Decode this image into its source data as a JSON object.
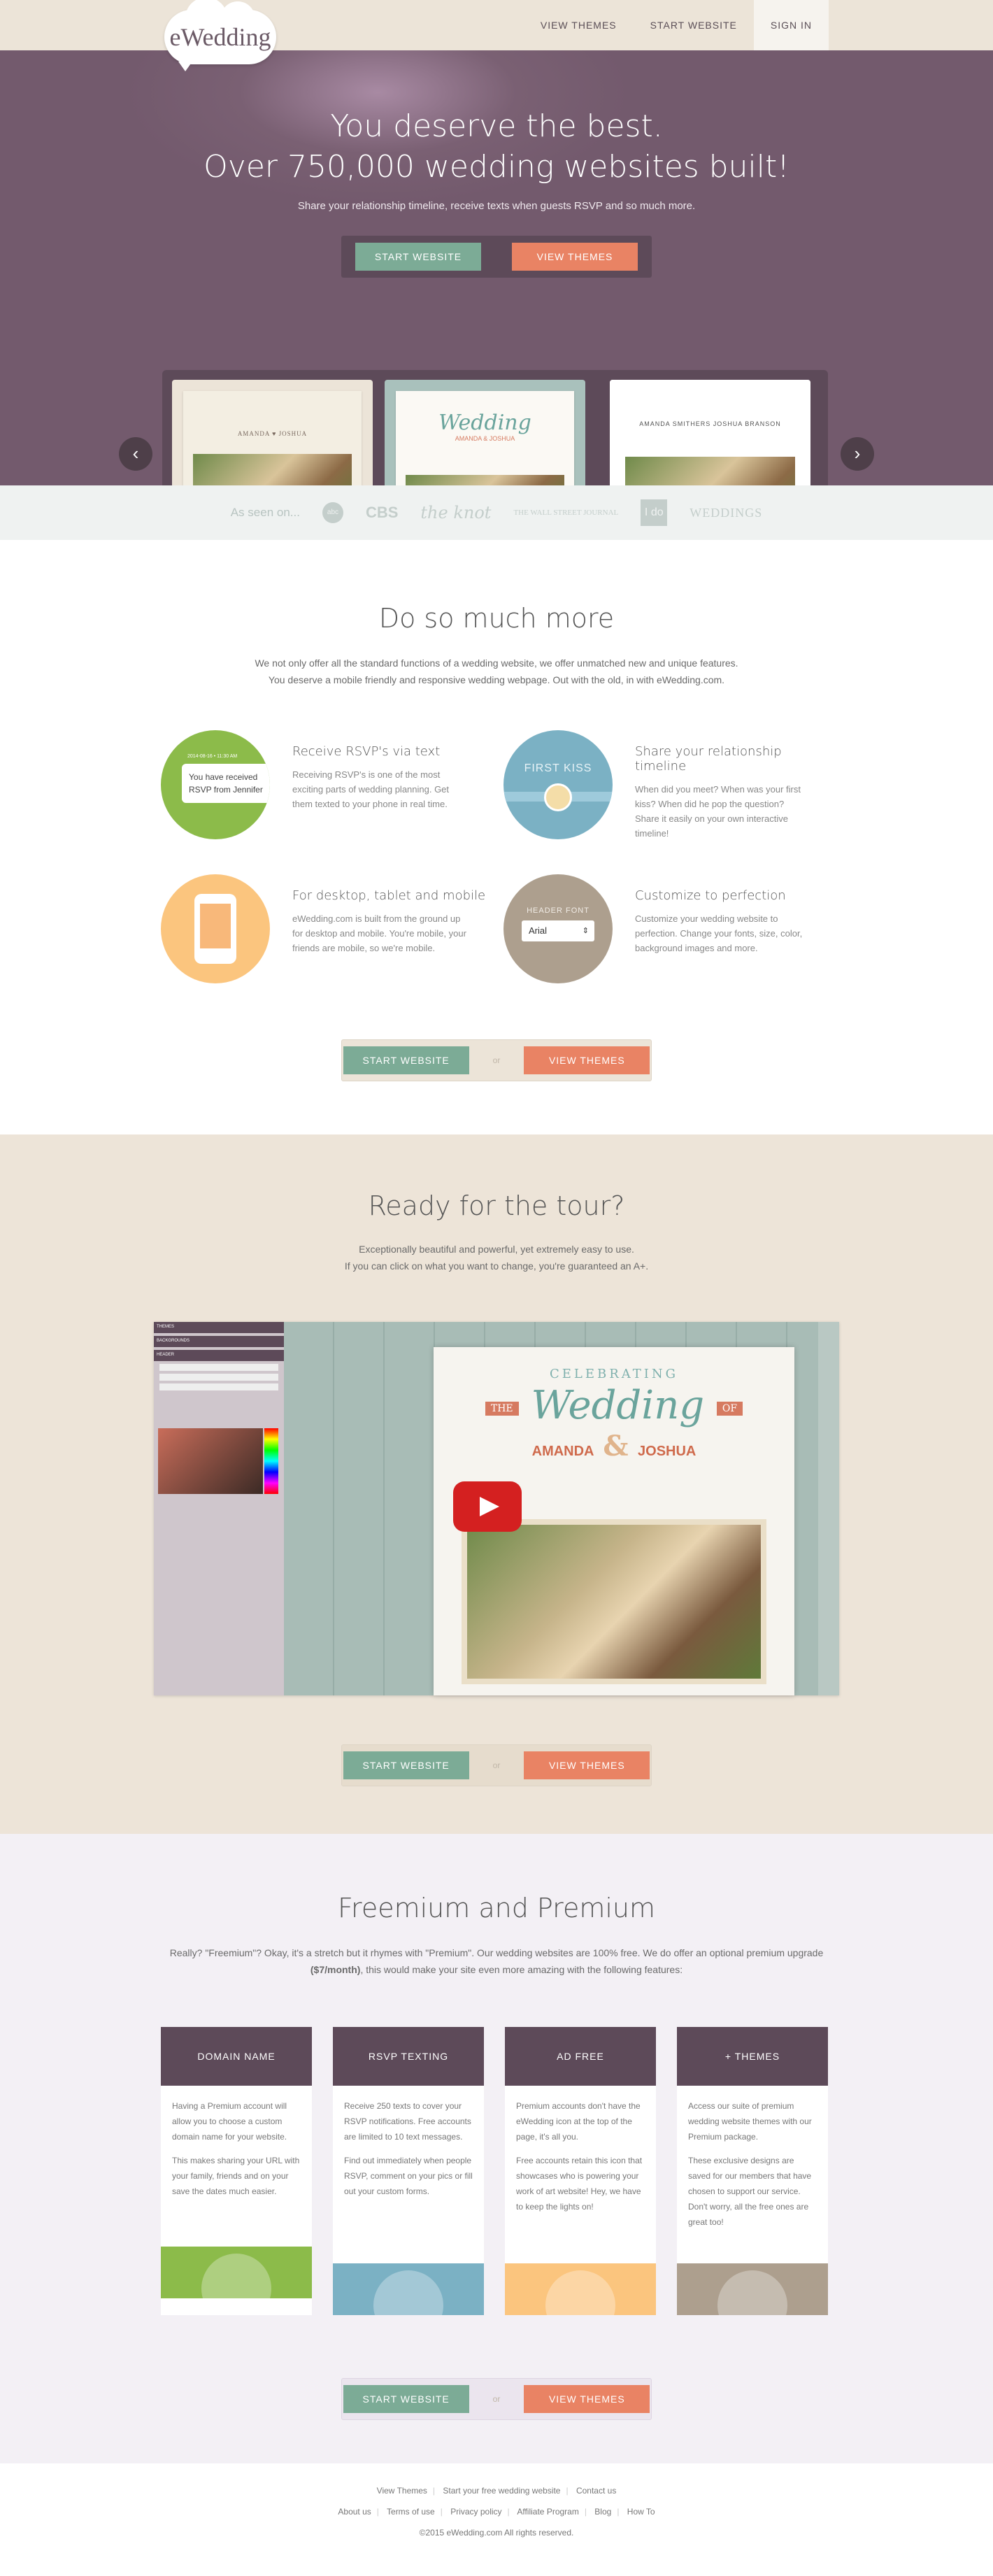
{
  "nav": {
    "logo": "eWedding",
    "links": [
      "VIEW THEMES",
      "START WEBSITE",
      "SIGN IN"
    ]
  },
  "hero": {
    "title_line1": "You deserve the best.",
    "title_line2": "Over 750,000 wedding websites built!",
    "subtitle": "Share your relationship timeline, receive texts when guests RSVP and so much more.",
    "start_btn": "START WEBSITE",
    "themes_btn": "VIEW THEMES",
    "cards": [
      {
        "text": "AMANDA  ♥  JOSHUA"
      },
      {
        "text": "Wedding",
        "names": "AMANDA & JOSHUA"
      },
      {
        "text": "AMANDA SMITHERS      JOSHUA BRANSON"
      }
    ],
    "prev_arrow": "‹",
    "next_arrow": "›"
  },
  "seen": {
    "label": "As seen on...",
    "brands": [
      "abc",
      "CBS",
      "the knot",
      "THE WALL STREET JOURNAL",
      "I do",
      "WEDDINGS"
    ]
  },
  "more": {
    "title": "Do so much more",
    "intro1": "We not only offer all the standard functions of a wedding website, we offer unmatched new and unique features.",
    "intro2": "You deserve a mobile friendly and responsive wedding webpage. Out with the old, in with eWedding.com.",
    "features": [
      {
        "title": "Receive RSVP's via text",
        "text": "Receiving RSVP's is one of the most exciting parts of wedding planning. Get them texted to your phone in real time.",
        "bubble": "You have received RSVP from Jennifer",
        "bubble_date": "2014-08-16 • 11:30 AM"
      },
      {
        "title": "Share your relationship timeline",
        "text": "When did you meet? When was your first kiss? When did he pop the question? Share it easily on your own interactive timeline!",
        "label": "FIRST KISS"
      },
      {
        "title": "For desktop, tablet and mobile",
        "text": "eWedding.com is built from the ground up for desktop and mobile. You're mobile, your friends are mobile, so we're mobile."
      },
      {
        "title": "Customize to perfection",
        "text": "Customize your wedding website to perfection. Change your fonts, size, color, background images and more.",
        "label": "HEADER FONT",
        "select": "Arial"
      }
    ],
    "start_btn": "START WEBSITE",
    "or": "or",
    "themes_btn": "VIEW THEMES"
  },
  "tour": {
    "title": "Ready for the tour?",
    "intro1": "Exceptionally beautiful and powerful, yet extremely easy to use.",
    "intro2": "If you can click on what you want to change, you're guaranteed an A+.",
    "video": {
      "side_bars": [
        "THEMES",
        "BACKGROUNDS",
        "HEADER"
      ],
      "celebrating": "CELEBRATING",
      "the": "THE",
      "wedding": "Wedding",
      "of": "OF",
      "name1": "AMANDA",
      "name2": "JOSHUA",
      "amp": "&"
    },
    "start_btn": "START WEBSITE",
    "or": "or",
    "themes_btn": "VIEW THEMES"
  },
  "premium": {
    "title": "Freemium and Premium",
    "intro": "Really? \"Freemium\"? Okay, it's a stretch but it rhymes with \"Premium\". Our wedding websites are 100% free. We do offer an optional premium upgrade",
    "intro_price": "($7/month)",
    "intro_end": ", this would make your site even more amazing with the following features:",
    "plans": [
      {
        "title": "DOMAIN NAME",
        "p1": "Having a Premium account will allow you to choose a custom domain name for your website.",
        "p2": "This makes sharing your URL with your family, friends and on your save the dates much easier."
      },
      {
        "title": "RSVP TEXTING",
        "p1": "Receive 250 texts to cover your RSVP notifications. Free accounts are limited to 10 text messages.",
        "p2": "Find out immediately when people RSVP, comment on your pics or fill out your custom forms."
      },
      {
        "title": "AD FREE",
        "p1": "Premium accounts don't have the eWedding icon at the top of the page, it's all you.",
        "p2": "Free accounts retain this icon that showcases who is powering your work of art website! Hey, we have to keep the lights on!"
      },
      {
        "title": "+ THEMES",
        "p1": "Access our suite of premium wedding website themes with our Premium package.",
        "p2": "These exclusive designs are saved for our members that have chosen to support our service. Don't worry, all the free ones are great too!"
      }
    ],
    "start_btn": "START WEBSITE",
    "or": "or",
    "themes_btn": "VIEW THEMES"
  },
  "footer": {
    "row1": [
      "View Themes",
      "Start your free wedding website",
      "Contact us"
    ],
    "row2": [
      "About us",
      "Terms of use",
      "Privacy policy",
      "Affiliate Program",
      "Blog",
      "How To"
    ],
    "copyright": "©2015 eWedding.com All rights reserved."
  },
  "colors": {
    "hero_bg": "#735a6d",
    "cream": "#ece4d8",
    "green": "#7cab96",
    "orange": "#e98364",
    "plum": "#5d4a59"
  }
}
